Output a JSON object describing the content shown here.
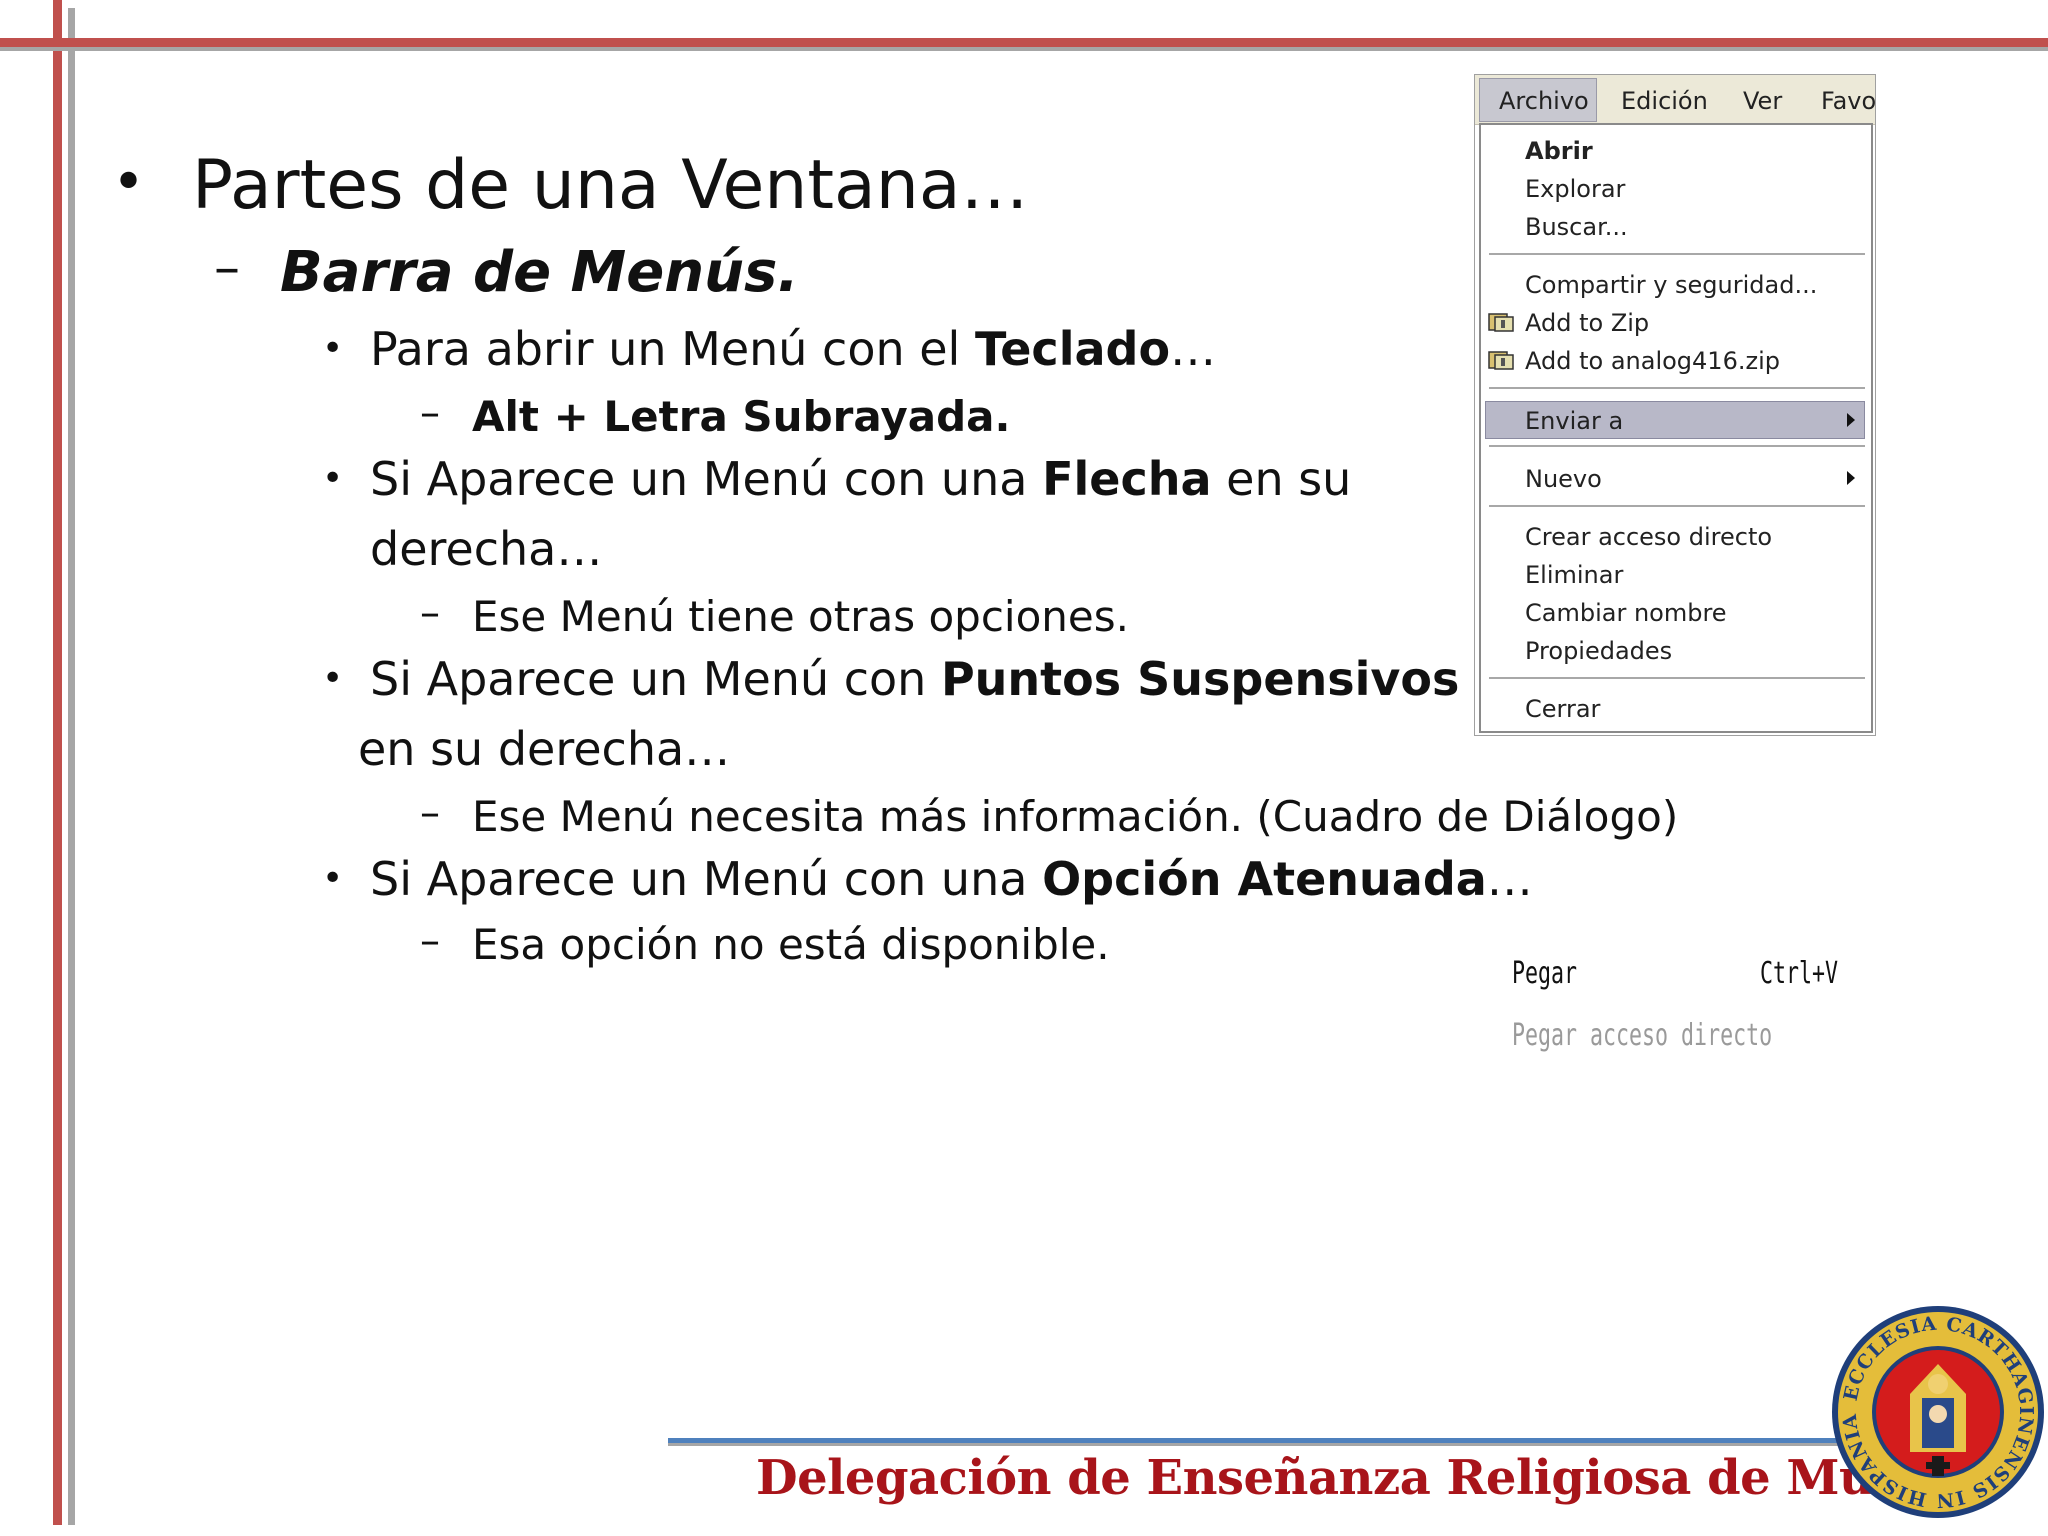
{
  "slide": {
    "heading": "Partes de una Ventana…",
    "subheading": "Barra de Menús.",
    "points": [
      {
        "text_before": "Para abrir un Menú con el ",
        "bold": "Teclado",
        "text_after": "…",
        "sub": "Alt + Letra Subrayada."
      },
      {
        "text_before": "Si Aparece un Menú con una ",
        "bold": "Flecha",
        "text_after": " en su",
        "continuation": "derecha…",
        "sub": "Ese Menú tiene otras opciones."
      },
      {
        "text_before": "Si Aparece un Menú con ",
        "bold": "Puntos Suspensivos",
        "text_after": "",
        "continuation": "en su derecha…",
        "sub": "Ese Menú necesita más información. (Cuadro de Diálogo)"
      },
      {
        "text_before": "Si Aparece un Menú con una ",
        "bold": "Opción Atenuada",
        "text_after": "…",
        "sub": "Esa opción no está disponible."
      }
    ]
  },
  "menu_screenshot": {
    "menubar": [
      "Archivo",
      "Edición",
      "Ver",
      "Favo"
    ],
    "items": {
      "abrir": "Abrir",
      "explorar": "Explorar",
      "buscar": "Buscar...",
      "compartir": "Compartir y seguridad...",
      "add_zip": "Add to Zip",
      "add_analog": "Add to analog416.zip",
      "enviar": "Enviar a",
      "nuevo": "Nuevo",
      "crear": "Crear acceso directo",
      "eliminar": "Eliminar",
      "cambiar": "Cambiar nombre",
      "propiedades": "Propiedades",
      "cerrar": "Cerrar"
    }
  },
  "paste_snippet": {
    "pegar": "Pegar",
    "shortcut": "Ctrl+V",
    "pegar_directo": "Pegar acceso directo"
  },
  "footer": {
    "text": "Delegación de Enseñanza Religiosa de Murcia",
    "seal_text": "ECCLESIA CARTHAGINENSIS IN HISPANIA"
  },
  "colors": {
    "accent_red": "#c0504d",
    "accent_gray": "#a6a6a6",
    "footer_text": "#a8141a",
    "footer_rule": "#4f81bd"
  }
}
